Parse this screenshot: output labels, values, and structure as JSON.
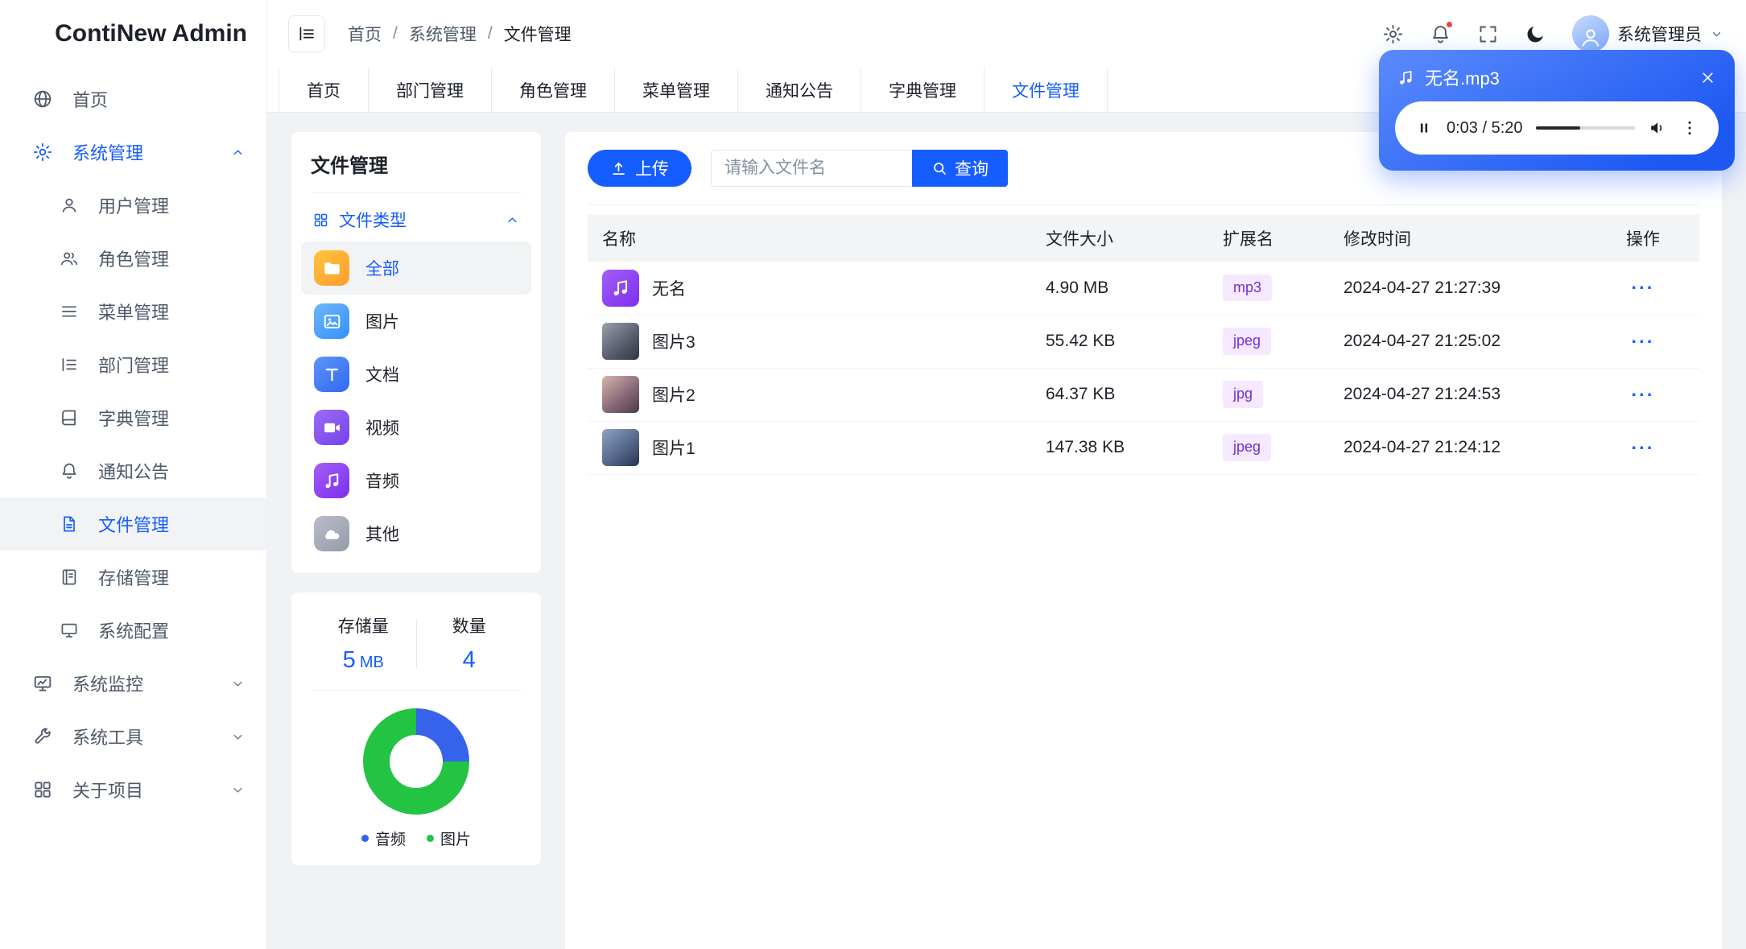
{
  "app": {
    "name": "ContiNew Admin"
  },
  "colors": {
    "primary": "#165DFF",
    "chart_audio": "#3662EC",
    "chart_image": "#23C343",
    "badge_bg": "#F5E8FF",
    "badge_text": "#722ED1",
    "notification_dot": "#F53F3F"
  },
  "header": {
    "breadcrumb": [
      "首页",
      "系统管理",
      "文件管理"
    ],
    "separator": "/",
    "user_name": "系统管理员"
  },
  "tabs": [
    "首页",
    "部门管理",
    "角色管理",
    "菜单管理",
    "通知公告",
    "字典管理",
    "文件管理"
  ],
  "active_tab": "文件管理",
  "sidebar": {
    "home": "首页",
    "system_group": "系统管理",
    "system_children": [
      "用户管理",
      "角色管理",
      "菜单管理",
      "部门管理",
      "字典管理",
      "通知公告",
      "文件管理",
      "存储管理",
      "系统配置"
    ],
    "active_item": "文件管理",
    "collapsed_groups": [
      "系统监控",
      "系统工具",
      "关于项目"
    ]
  },
  "file_panel": {
    "title": "文件管理",
    "type_section": "文件类型",
    "types": [
      "全部",
      "图片",
      "文档",
      "视频",
      "音频",
      "其他"
    ],
    "active_type": "全部",
    "stats": {
      "storage_label": "存储量",
      "storage_value": "5",
      "storage_unit": "MB",
      "count_label": "数量",
      "count_value": "4"
    }
  },
  "chart_data": {
    "type": "pie",
    "donut": true,
    "labels": [
      "音频",
      "图片"
    ],
    "values": [
      1,
      3
    ],
    "colors": [
      "#3662EC",
      "#23C343"
    ],
    "legend_position": "bottom"
  },
  "toolbar": {
    "upload_label": "上传",
    "search_placeholder": "请输入文件名",
    "search_label": "查询"
  },
  "table": {
    "columns": [
      "名称",
      "文件大小",
      "扩展名",
      "修改时间",
      "操作"
    ],
    "rows": [
      {
        "name": "无名",
        "size": "4.90 MB",
        "ext": "mp3",
        "time": "2024-04-27 21:27:39",
        "more": "···"
      },
      {
        "name": "图片3",
        "size": "55.42 KB",
        "ext": "jpeg",
        "time": "2024-04-27 21:25:02",
        "more": "···"
      },
      {
        "name": "图片2",
        "size": "64.37 KB",
        "ext": "jpg",
        "time": "2024-04-27 21:24:53",
        "more": "···"
      },
      {
        "name": "图片1",
        "size": "147.38 KB",
        "ext": "jpeg",
        "time": "2024-04-27 21:24:12",
        "more": "···"
      }
    ]
  },
  "player": {
    "title": "无名.mp3",
    "time": "0:03 / 5:20",
    "progress_pct": 45
  }
}
